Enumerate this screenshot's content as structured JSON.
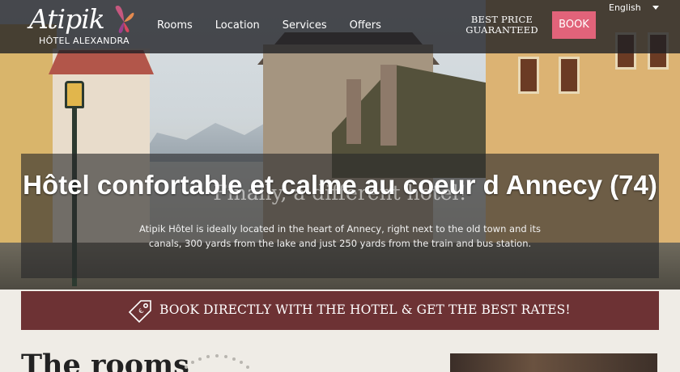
{
  "header": {
    "logo_main": "Atipik",
    "logo_sub": "HÔTEL ALEXANDRA",
    "nav": [
      "Rooms",
      "Location",
      "Services",
      "Offers"
    ],
    "best_price": "BEST PRICE GUARANTEED",
    "book_label": "BOOK",
    "language": "English"
  },
  "intro": {
    "background_title": "Finally, a different hotel!",
    "text": "Atipik Hôtel is ideally located in the heart of Annecy, right next to the old town and its canals, 300 yards from the lake and just 250 yards from the train and bus station."
  },
  "seo_title": "Hôtel confortable et calme au coeur d Annecy (74)",
  "banner": {
    "text": "BOOK DIRECTLY WITH THE HOTEL & GET THE BEST RATES!",
    "icon": "price-tag-icon"
  },
  "rooms": {
    "heading": "The rooms"
  },
  "colors": {
    "book_button": "#e1637a",
    "banner": "#6d3234",
    "topbar": "#1c1e22"
  }
}
